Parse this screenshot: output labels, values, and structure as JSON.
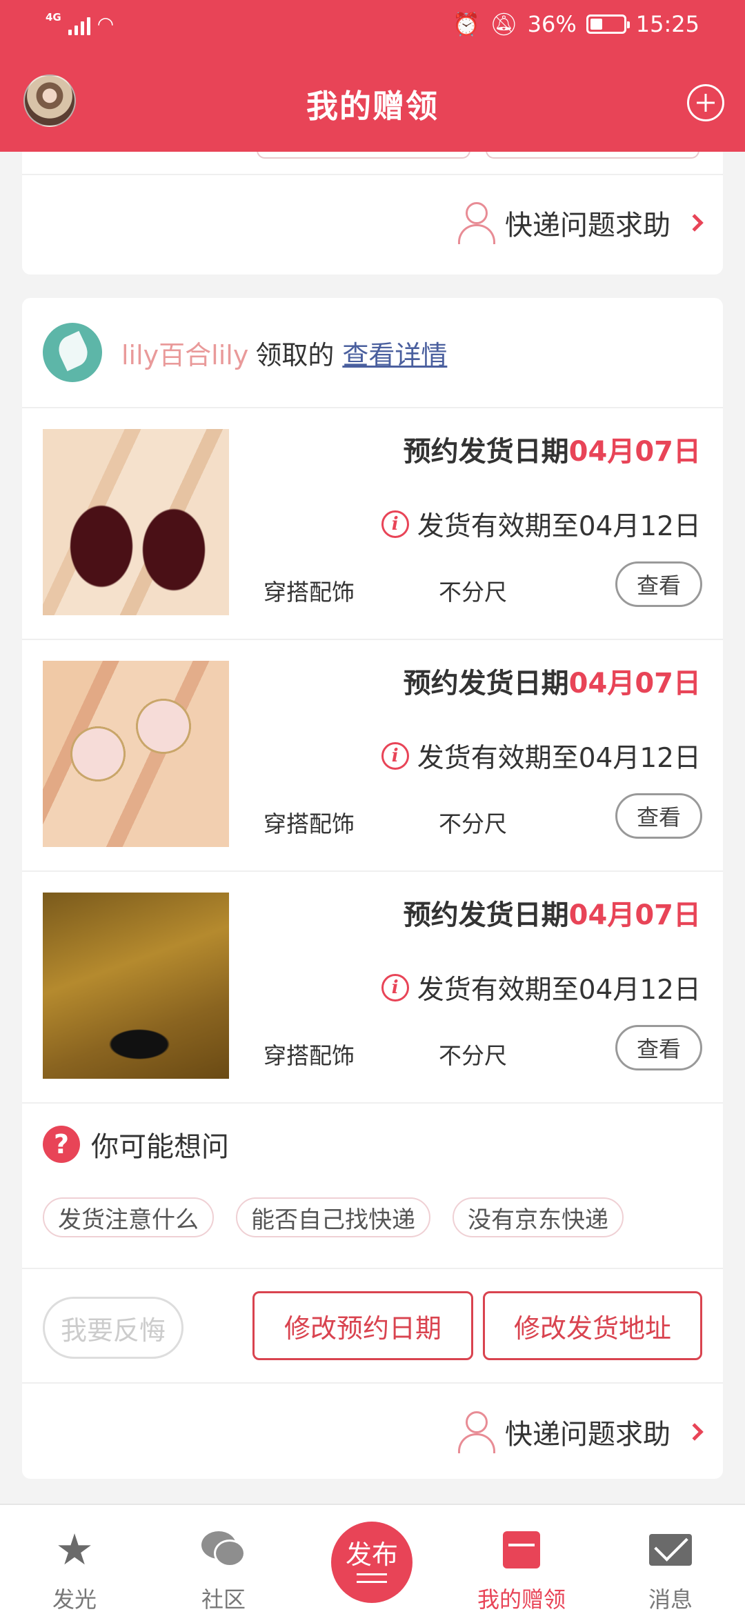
{
  "status": {
    "network": "4G",
    "battery": "36%",
    "time": "15:25"
  },
  "header": {
    "title": "我的赠领"
  },
  "help": {
    "label": "快递问题求助"
  },
  "claim": {
    "claimer": "lily百合lily",
    "suffix": "领取的",
    "link": "查看详情"
  },
  "items": [
    {
      "ship_label": "预约发货日期",
      "ship_date": "04月07日",
      "validity": "发货有效期至04月12日",
      "category": "穿搭配饰",
      "size": "不分尺",
      "view": "查看"
    },
    {
      "ship_label": "预约发货日期",
      "ship_date": "04月07日",
      "validity": "发货有效期至04月12日",
      "category": "穿搭配饰",
      "size": "不分尺",
      "view": "查看"
    },
    {
      "ship_label": "预约发货日期",
      "ship_date": "04月07日",
      "validity": "发货有效期至04月12日",
      "category": "穿搭配饰",
      "size": "不分尺",
      "view": "查看"
    }
  ],
  "faq": {
    "title": "你可能想问",
    "chips": [
      "发货注意什么",
      "能否自己找快递",
      "没有京东快递"
    ]
  },
  "actions": {
    "regret": "我要反悔",
    "change_date": "修改预约日期",
    "change_address": "修改发货地址"
  },
  "nav": {
    "items": [
      "发光",
      "社区",
      "我的赠领",
      "消息"
    ],
    "publish": "发布",
    "active": "我的赠领"
  },
  "colors": {
    "brand": "#e84457",
    "link": "#4a5f9e",
    "claimer": "#e99a9a"
  }
}
